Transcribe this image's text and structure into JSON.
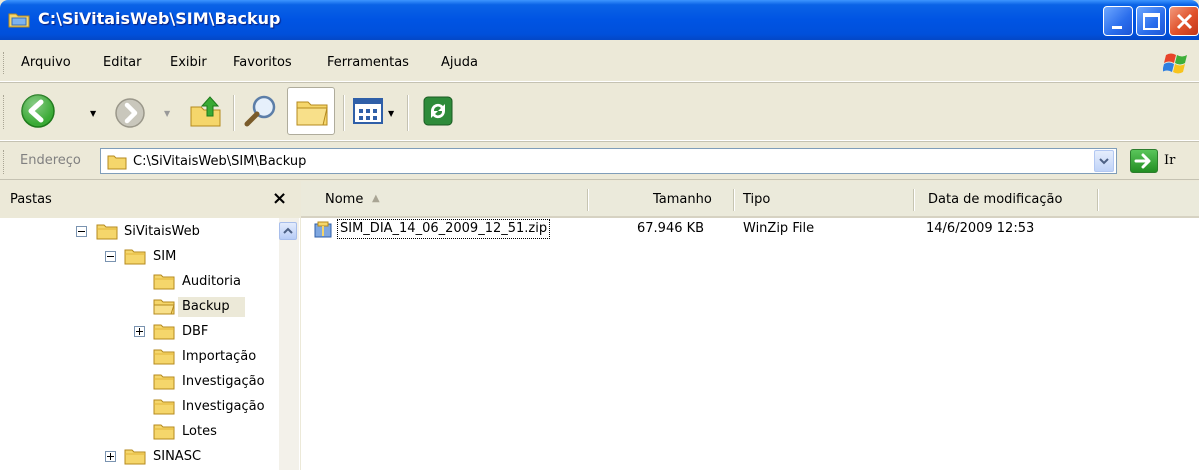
{
  "window": {
    "title": "C:\\SiVitaisWeb\\SIM\\Backup"
  },
  "menu": {
    "items": [
      "Arquivo",
      "Editar",
      "Exibir",
      "Favoritos",
      "Ferramentas",
      "Ajuda"
    ]
  },
  "toolbar": {
    "buttons": [
      "back-icon",
      "forward-icon",
      "up-folder-icon",
      "search-icon",
      "folders-icon",
      "views-icon",
      "sync-icon"
    ]
  },
  "address": {
    "label": "Endereço",
    "path": "C:\\SiVitaisWeb\\SIM\\Backup",
    "go_label": "Ir"
  },
  "folders_pane": {
    "title": "Pastas",
    "close_label": "×",
    "tree": [
      {
        "label": "SiVitaisWeb",
        "level": 0,
        "expander": "minus"
      },
      {
        "label": "SIM",
        "level": 1,
        "expander": "minus"
      },
      {
        "label": "Auditoria",
        "level": 2,
        "expander": "none"
      },
      {
        "label": "Backup",
        "level": 2,
        "expander": "none",
        "selected": true
      },
      {
        "label": "DBF",
        "level": 2,
        "expander": "plus"
      },
      {
        "label": "Importação",
        "level": 2,
        "expander": "none"
      },
      {
        "label": "Investigação",
        "level": 2,
        "expander": "none"
      },
      {
        "label": "Investigação",
        "level": 2,
        "expander": "none"
      },
      {
        "label": "Lotes",
        "level": 2,
        "expander": "none"
      },
      {
        "label": "SINASC",
        "level": 1,
        "expander": "plus"
      }
    ]
  },
  "file_list": {
    "columns": {
      "name": "Nome",
      "size": "Tamanho",
      "type": "Tipo",
      "modified": "Data de modificação"
    },
    "sort_indicator": "▲",
    "rows": [
      {
        "name": "SIM_DIA_14_06_2009_12_51.zip",
        "size": "67.946 KB",
        "type": "WinZip File",
        "modified": "14/6/2009 12:53"
      }
    ]
  },
  "colors": {
    "titlebar": "#0054E3",
    "chrome": "#ECE9D8",
    "folder_yellow": "#F5D66B"
  }
}
